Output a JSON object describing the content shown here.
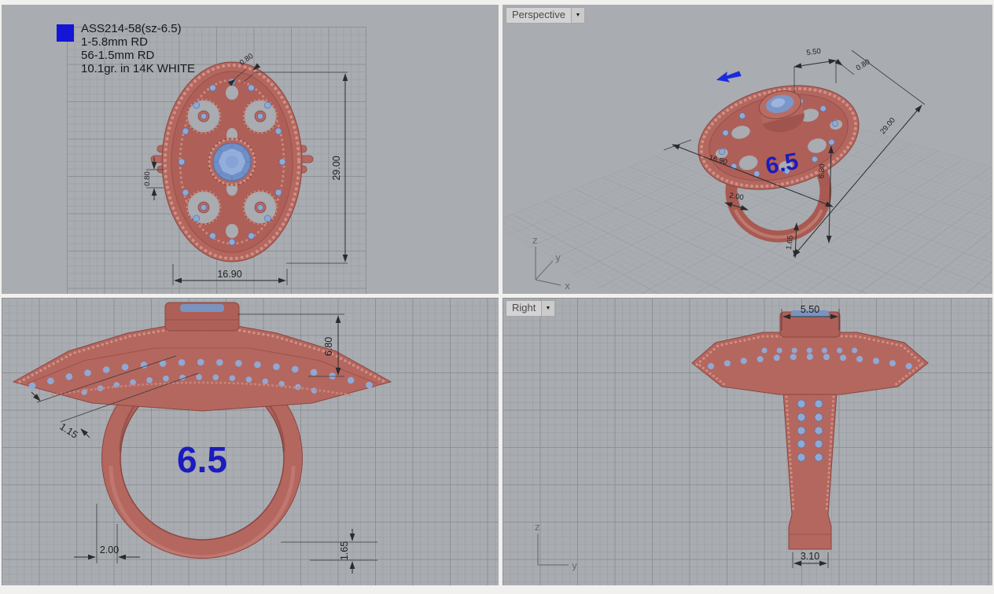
{
  "window": {
    "frame_color": "#f2f0ee",
    "viewport_bg": "#a9acb1"
  },
  "colors": {
    "grid_minor": "#9fa2a7",
    "grid_major": "#8d9095",
    "ring_metal": "#b4675f",
    "ring_metal_dark": "#8a4640",
    "ring_metal_light": "#cf9186",
    "gem_blue": "#8fa9d4",
    "gem_blue_dark": "#4a6da8",
    "dimension_text": "#202020",
    "annotation_swatch_blue": "#1515d6",
    "ring_size_blue": "#1b1bbe",
    "viewport_tab_bg": "#d3d3d3"
  },
  "icons": {
    "dropdown_arrow": "▼"
  },
  "viewports": {
    "top": {
      "annotation": {
        "line1": "ASS214-58(sz-6.5)",
        "line2": "1-5.8mm RD",
        "line3": "56-1.5mm RD",
        "line4": "10.1gr. in 14K WHITE"
      },
      "dimensions": {
        "bead_top": "0.80",
        "height": "29.00",
        "bead_side": "0.80",
        "width": "16.90"
      }
    },
    "perspective": {
      "label": "Perspective",
      "dimensions": {
        "bezel_width": "5.50",
        "bead": "0.80",
        "height": "29.00",
        "width": "16.90",
        "head_height": "6.80",
        "band_width": "2.00",
        "band_thickness": "1.65"
      },
      "ring_size": "6.5",
      "axis": {
        "x": "x",
        "y": "y",
        "z": "z"
      }
    },
    "front": {
      "dimensions": {
        "head_height": "6.80",
        "shoulder_width": "1.15",
        "band_width": "2.00",
        "band_thickness": "1.65"
      },
      "ring_size": "6.5"
    },
    "right": {
      "label": "Right",
      "dimensions": {
        "bezel_width": "5.50",
        "shank_width": "3.10"
      },
      "axis": {
        "z": "z",
        "y": "y"
      }
    }
  }
}
